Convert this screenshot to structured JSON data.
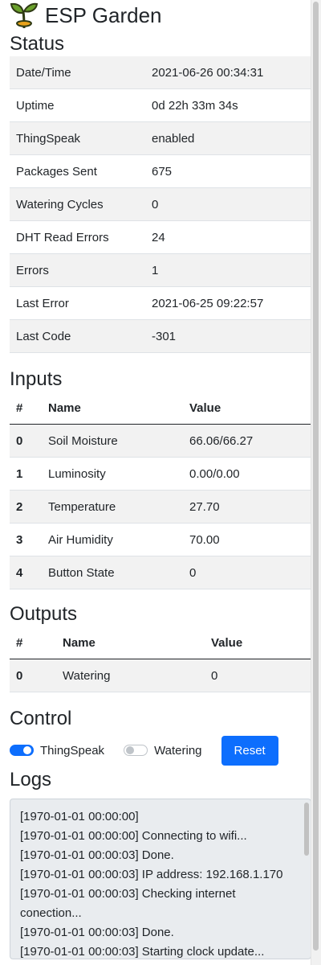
{
  "header": {
    "title": "ESP Garden"
  },
  "status": {
    "heading": "Status",
    "rows": [
      {
        "label": "Date/Time",
        "value": "2021-06-26 00:34:31"
      },
      {
        "label": "Uptime",
        "value": "0d 22h 33m 34s"
      },
      {
        "label": "ThingSpeak",
        "value": "enabled"
      },
      {
        "label": "Packages Sent",
        "value": "675"
      },
      {
        "label": "Watering Cycles",
        "value": "0"
      },
      {
        "label": "DHT Read Errors",
        "value": "24"
      },
      {
        "label": "Errors",
        "value": "1"
      },
      {
        "label": "Last Error",
        "value": "2021-06-25 09:22:57"
      },
      {
        "label": "Last Code",
        "value": "-301"
      }
    ]
  },
  "inputs": {
    "heading": "Inputs",
    "columns": [
      "#",
      "Name",
      "Value"
    ],
    "rows": [
      {
        "idx": "0",
        "name": "Soil Moisture",
        "value": "66.06/66.27"
      },
      {
        "idx": "1",
        "name": "Luminosity",
        "value": "0.00/0.00"
      },
      {
        "idx": "2",
        "name": "Temperature",
        "value": "27.70"
      },
      {
        "idx": "3",
        "name": "Air Humidity",
        "value": "70.00"
      },
      {
        "idx": "4",
        "name": "Button State",
        "value": "0"
      }
    ]
  },
  "outputs": {
    "heading": "Outputs",
    "columns": [
      "#",
      "Name",
      "Value"
    ],
    "rows": [
      {
        "idx": "0",
        "name": "Watering",
        "value": "0"
      }
    ]
  },
  "control": {
    "heading": "Control",
    "thingspeak_label": "ThingSpeak",
    "thingspeak_on": true,
    "watering_label": "Watering",
    "watering_on": false,
    "reset_label": "Reset",
    "accent_color": "#0d6efd"
  },
  "logs": {
    "heading": "Logs",
    "lines": [
      "[1970-01-01 00:00:00]",
      "[1970-01-01 00:00:00] Connecting to wifi...",
      "[1970-01-01 00:00:03] Done.",
      "[1970-01-01 00:00:03] IP address: 192.168.1.170",
      "[1970-01-01 00:00:03] Checking internet conection...",
      "[1970-01-01 00:00:03] Done.",
      "[1970-01-01 00:00:03] Starting clock update..."
    ]
  },
  "icons": {
    "logo": "sprout-icon"
  }
}
